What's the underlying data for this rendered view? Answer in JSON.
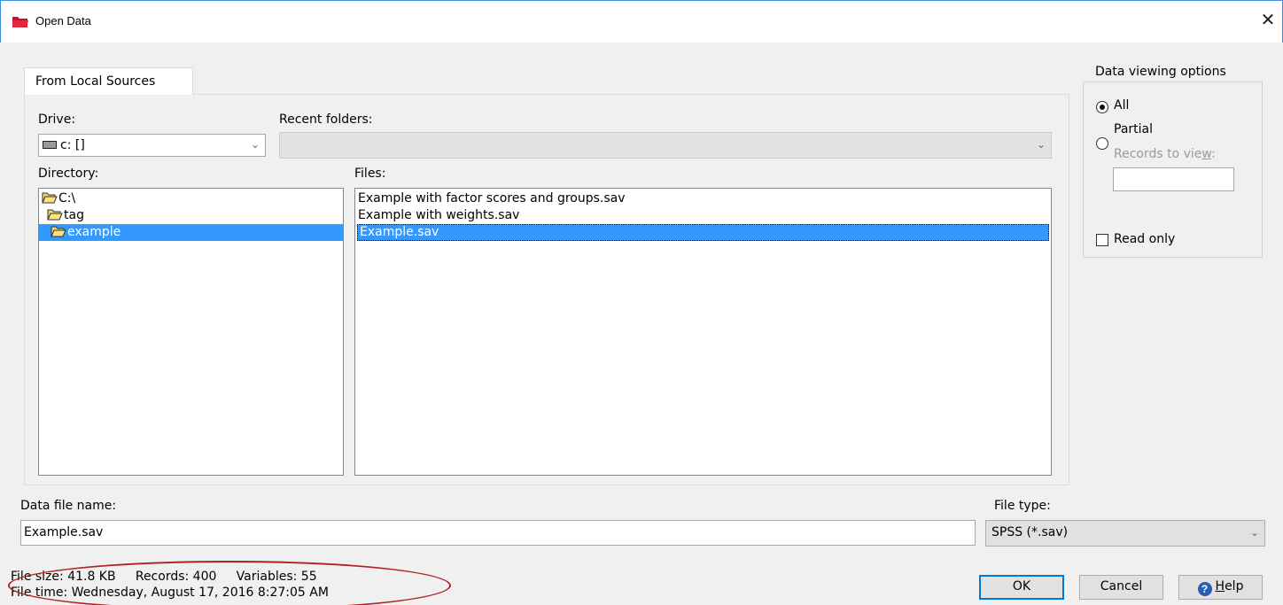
{
  "window": {
    "title": "Open Data",
    "close_glyph": "✕",
    "app_icon": "red-folder-icon",
    "accent_color": "#3399ff"
  },
  "tabs": [
    {
      "label": "From Local Sources",
      "active": true
    }
  ],
  "drive": {
    "label": "Drive:",
    "value": "c: []",
    "icon": "drive-icon"
  },
  "recent_folders": {
    "label": "Recent folders:",
    "value": ""
  },
  "directory": {
    "label": "Directory:",
    "items": [
      {
        "name": "C:\\",
        "icon": "open-folder-icon",
        "selected": false
      },
      {
        "name": "tag",
        "icon": "open-folder-icon",
        "selected": false
      },
      {
        "name": "example",
        "icon": "open-folder-icon",
        "selected": true
      }
    ]
  },
  "files": {
    "label": "Files:",
    "items": [
      {
        "name": "Example with factor scores and groups.sav",
        "selected": false
      },
      {
        "name": "Example with weights.sav",
        "selected": false
      },
      {
        "name": "Example.sav",
        "selected": true
      }
    ]
  },
  "viewing_options": {
    "legend": "Data viewing options",
    "all_label": "All",
    "all_checked": true,
    "partial_label": "Partial",
    "partial_checked": false,
    "records_label_pre": "Records to vie",
    "records_label_accel": "w",
    "records_label_post": ":",
    "records_value": "",
    "read_only_label": "Read only",
    "read_only_checked": false
  },
  "data_file_name": {
    "label": "Data file name:",
    "value": "Example.sav"
  },
  "file_type": {
    "label": "File type:",
    "value": "SPSS (*.sav)"
  },
  "status": {
    "line1": "File size: 41.8 KB     Records: 400     Variables: 55",
    "line2": "File time: Wednesday, August 17, 2016 8:27:05 AM"
  },
  "buttons": {
    "ok": "OK",
    "cancel": "Cancel",
    "help_accel": "H",
    "help_rest": "elp"
  }
}
